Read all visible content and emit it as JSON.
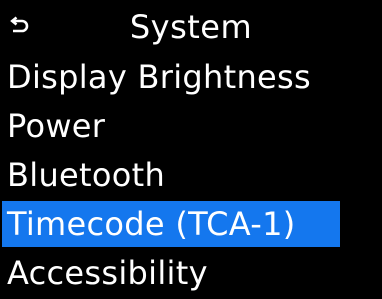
{
  "header": {
    "back_icon": "return-arrow-icon",
    "title": "System"
  },
  "menu": {
    "items": [
      {
        "label": "Display Brightness",
        "selected": false
      },
      {
        "label": "Power",
        "selected": false
      },
      {
        "label": "Bluetooth",
        "selected": false
      },
      {
        "label": "Timecode (TCA-1)",
        "selected": true
      },
      {
        "label": "Accessibility",
        "selected": false
      }
    ]
  },
  "colors": {
    "background": "#000000",
    "text": "#ffffff",
    "selection": "#1477ee"
  }
}
